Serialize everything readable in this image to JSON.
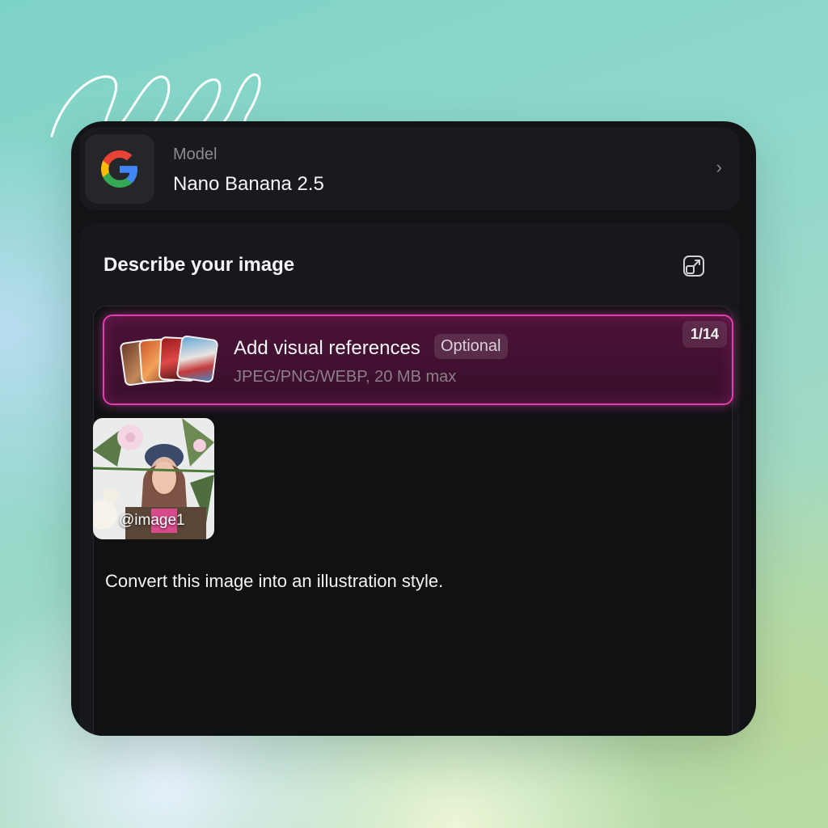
{
  "model": {
    "label": "Model",
    "name": "Nano Banana 2.5",
    "logo_icon": "google-g-icon",
    "chevron_icon": "chevron-right-icon"
  },
  "prompt": {
    "title": "Describe your image",
    "expand_icon": "expand-icon",
    "text": "Convert this image into an illustration style."
  },
  "references": {
    "title": "Add visual references",
    "optional_label": "Optional",
    "formats": "JPEG/PNG/WEBP, 20 MB max",
    "count": "1/14",
    "accent_color": "#e13fae"
  },
  "attachments": [
    {
      "tag": "@image1"
    }
  ]
}
